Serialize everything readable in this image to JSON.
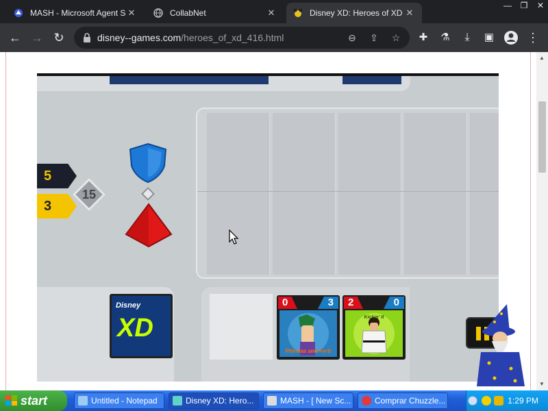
{
  "browser": {
    "tabs": [
      {
        "title": "MASH - Microsoft Agent Scr",
        "active": false
      },
      {
        "title": "CollabNet",
        "active": false
      },
      {
        "title": "Disney XD: Heroes of XD | D",
        "active": true
      }
    ],
    "window_controls": [
      "—",
      "❐",
      "✕"
    ],
    "url_domain": "disney--games.com",
    "url_path": "/heroes_of_xd_416.html"
  },
  "game": {
    "player_score": "5",
    "opponent_score": "3",
    "deck_count": "15",
    "logo_brand": "Disney",
    "logo_text": "XD",
    "cards": [
      {
        "name": "Ferb",
        "attack": "0",
        "defense": "3",
        "caption": "Phineas and Ferb"
      },
      {
        "name": "Kickin' It",
        "attack": "2",
        "defense": "0",
        "caption": "Kickin' It"
      }
    ],
    "colors": {
      "shield": "#1e78d6",
      "gem": "#e01818",
      "score_top": "#1b1f2b",
      "score_bottom": "#f5c400",
      "board": "#cdd1d4"
    }
  },
  "taskbar": {
    "start_label": "start",
    "tasks": [
      {
        "label": "Untitled - Notepad",
        "active": false
      },
      {
        "label": "Disney XD: Hero...",
        "active": true
      },
      {
        "label": "MASH - [ New Sc...",
        "active": false
      },
      {
        "label": "Comprar Chuzzle...",
        "active": false
      }
    ],
    "clock": "1:29 PM"
  }
}
